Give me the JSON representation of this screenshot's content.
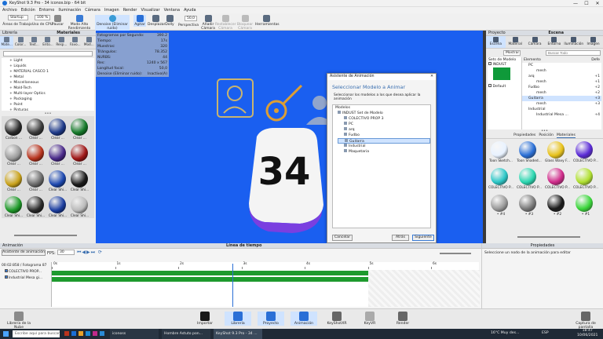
{
  "titlebar": {
    "title": "KeyShot 9.3 Pro - 34 iconos.bip - 64 bit",
    "min": "—",
    "max": "☐",
    "close": "✕"
  },
  "menu": [
    "Archivo",
    "Edición",
    "Entorno",
    "Iluminación",
    "Cámara",
    "Imagen",
    "Render",
    "Visualizar",
    "Ventana",
    "Ayuda"
  ],
  "toolbar": {
    "workspace_value": "Startup",
    "workspaces_label": "Áreas de Trabajo",
    "cpu_value": "100 %",
    "cpu_label": "Uso de CPU",
    "pause_label": "Pausar",
    "performance_label": "Modo Alto Rendimiento",
    "denoise_label": "Denoise (Eliminar ruido)",
    "shake_label": "Agitar",
    "pan_label": "Desplazar",
    "dolly_label": "Dolly",
    "fov_value": "50,0",
    "perspective_label": "Perspectiva",
    "add_camera_label": "Añadir Cámara",
    "reset_camera_label": "Restablecer Cámara",
    "lock_camera_label": "Bloquear Cámara",
    "tools_label": "Herramientas"
  },
  "library": {
    "title": "Librería",
    "tab_title": "Materiales",
    "tabs": [
      "Mate...",
      "Color...",
      "Text...",
      "Ento...",
      "Resp...",
      "Favo...",
      "Mod..."
    ],
    "folders": [
      "Light",
      "Liquids",
      "MATERIAL CASCO 1",
      "Metal",
      "Miscellaneous",
      "Mold-Tech",
      "Multi-layer Optics",
      "Packaging",
      "Paint",
      "Pinturas",
      "Plastic",
      "RealCloth"
    ],
    "materials": [
      {
        "label": "Carbon ...",
        "color": "#2b2b2b"
      },
      {
        "label": "Clear ...",
        "color": "#3c3c3c"
      },
      {
        "label": "Clear ...",
        "color": "#1e3a8a"
      },
      {
        "label": "Clear ...",
        "color": "#157a2a"
      },
      {
        "label": "Clear ...",
        "color": "#9a9a9a"
      },
      {
        "label": "Clear ...",
        "color": "#b8341e"
      },
      {
        "label": "Clear ...",
        "color": "#4a2a8a"
      },
      {
        "label": "Clear ...",
        "color": "#a01818"
      },
      {
        "label": "Clear ...",
        "color": "#c9a21a"
      },
      {
        "label": "Clear ...",
        "color": "#6a6a6a"
      },
      {
        "label": "Clear Shi...",
        "color": "#1e49b0"
      },
      {
        "label": "Clear Shi...",
        "color": "#1a1a1a"
      },
      {
        "label": "Clear Shi...",
        "color": "#1f9a2a"
      },
      {
        "label": "Clear Shi...",
        "color": "#2a2a2a"
      },
      {
        "label": "Clear Shi...",
        "color": "#1c3ea0"
      },
      {
        "label": "Clear Shi...",
        "color": "#bababa"
      }
    ]
  },
  "hud": [
    [
      "Fotogramas por Segundo:",
      "390.2"
    ],
    [
      "Tiempo:",
      "17s"
    ],
    [
      "Muestras:",
      "320"
    ],
    [
      "Triángulos:",
      "78.352"
    ],
    [
      "NURBS:",
      "44"
    ],
    [
      "Res:",
      "1240 x 567"
    ],
    [
      "Longitud focal:",
      "50,0"
    ],
    [
      "Denoise (Eliminar ruido):",
      "Inactivo(A)"
    ]
  ],
  "scene": {
    "number": "34"
  },
  "dialog": {
    "title": "Asistente de Animación",
    "heading": "Seleccionar Modelo a Animar",
    "instruction": "Seleccionar los modelos a los que desea aplicar la animación",
    "models_label": "Modelos",
    "tree": [
      "INDUST Set de Modelo",
      "COLECTIVO PROP 3",
      "PC",
      "arq",
      "Fudbo",
      "Guitarra",
      "Industrial",
      "Maquetaria"
    ],
    "selected_index": 5,
    "cancel": "Cancelar",
    "back": "Atrás",
    "next": "Siguiente",
    "close": "✕"
  },
  "project": {
    "title": "Proyecto",
    "section": "Escena",
    "tabs": [
      "Escena",
      "Material",
      "Cámara",
      "Entorno",
      "Iluminación",
      "Imagen"
    ],
    "filter_value": "Mostrar",
    "search_placeholder": "Buscar Todo",
    "model_sets_label": "Sets de Modelo",
    "model_set_item": "INDUST",
    "default_label": "Default",
    "element_col": "Elemento",
    "def_col": "Defe",
    "elements": [
      [
        "PC",
        ""
      ],
      [
        "mesh",
        ""
      ],
      [
        "arq",
        "+1"
      ],
      [
        "mesh",
        "+1"
      ],
      [
        "Fudbo",
        "+2"
      ],
      [
        "mesh",
        "+2"
      ],
      [
        "Guitarra",
        "+3"
      ],
      [
        "mesh",
        "+3"
      ],
      [
        "Industrial",
        ""
      ],
      [
        "Industrial Mesa ...",
        "+4"
      ]
    ],
    "subtabs": [
      "Propiedades",
      "Posición",
      "Materiales"
    ],
    "mats": [
      {
        "label": "Toon Sketch...",
        "color": "#e8f2ff"
      },
      {
        "label": "Toon Shaded...",
        "color": "#2a6fd6"
      },
      {
        "label": "Glass Wavy F...",
        "color": "#e8c21a"
      },
      {
        "label": "COLECTIVO P...",
        "color": "#5a2ad6"
      },
      {
        "label": "COLECTIVO P...",
        "color": "#2ac6c6"
      },
      {
        "label": "COLECTIVO P...",
        "color": "#2ad6b0"
      },
      {
        "label": "COLECTIVO P...",
        "color": "#d02a8a"
      },
      {
        "label": "COLECTIVO P...",
        "color": "#b0e030"
      },
      {
        "label": "• #4",
        "color": "#9a9a9a"
      },
      {
        "label": "• #3",
        "color": "#7a7a7a"
      },
      {
        "label": "• #2",
        "color": "#1a1a1a"
      },
      {
        "label": "• #1",
        "color": "#3ad63a"
      }
    ]
  },
  "animation": {
    "title": "Animación",
    "timeline_title": "Línea de tiempo",
    "wizard_button": "Asistente de animación",
    "fps_label": "FPS:",
    "fps_value": "30",
    "time_readout": "00:02:858 / Fotograma 87",
    "ticks": [
      "0s",
      "1s",
      "2s",
      "3s",
      "4s",
      "5s",
      "6s"
    ],
    "tracks": [
      "COLECTIVO PROP...",
      "Industrial Mesa gi..."
    ],
    "playhead_seconds": 2.858
  },
  "properties": {
    "title": "Propiedades",
    "message": "Seleccione un nodo de la animación para editar"
  },
  "bottom": {
    "cloud": "Librería de la Nube",
    "buttons": [
      "Importar",
      "Librería",
      "Proyecto",
      "Animación",
      "KeyShotXR",
      "KeyVR",
      "Render"
    ],
    "screenshot": "Captura de pantalla"
  },
  "taskbar": {
    "search": "Escribe aquí para buscar",
    "apps": [
      "iconoss",
      "Hombre Astuto pon...",
      "KeyShot 9.3 Pro - 34 ..."
    ],
    "weather": "16°C Muy des...",
    "lang": "ESP",
    "time": "18:47",
    "date": "10/06/2021"
  }
}
